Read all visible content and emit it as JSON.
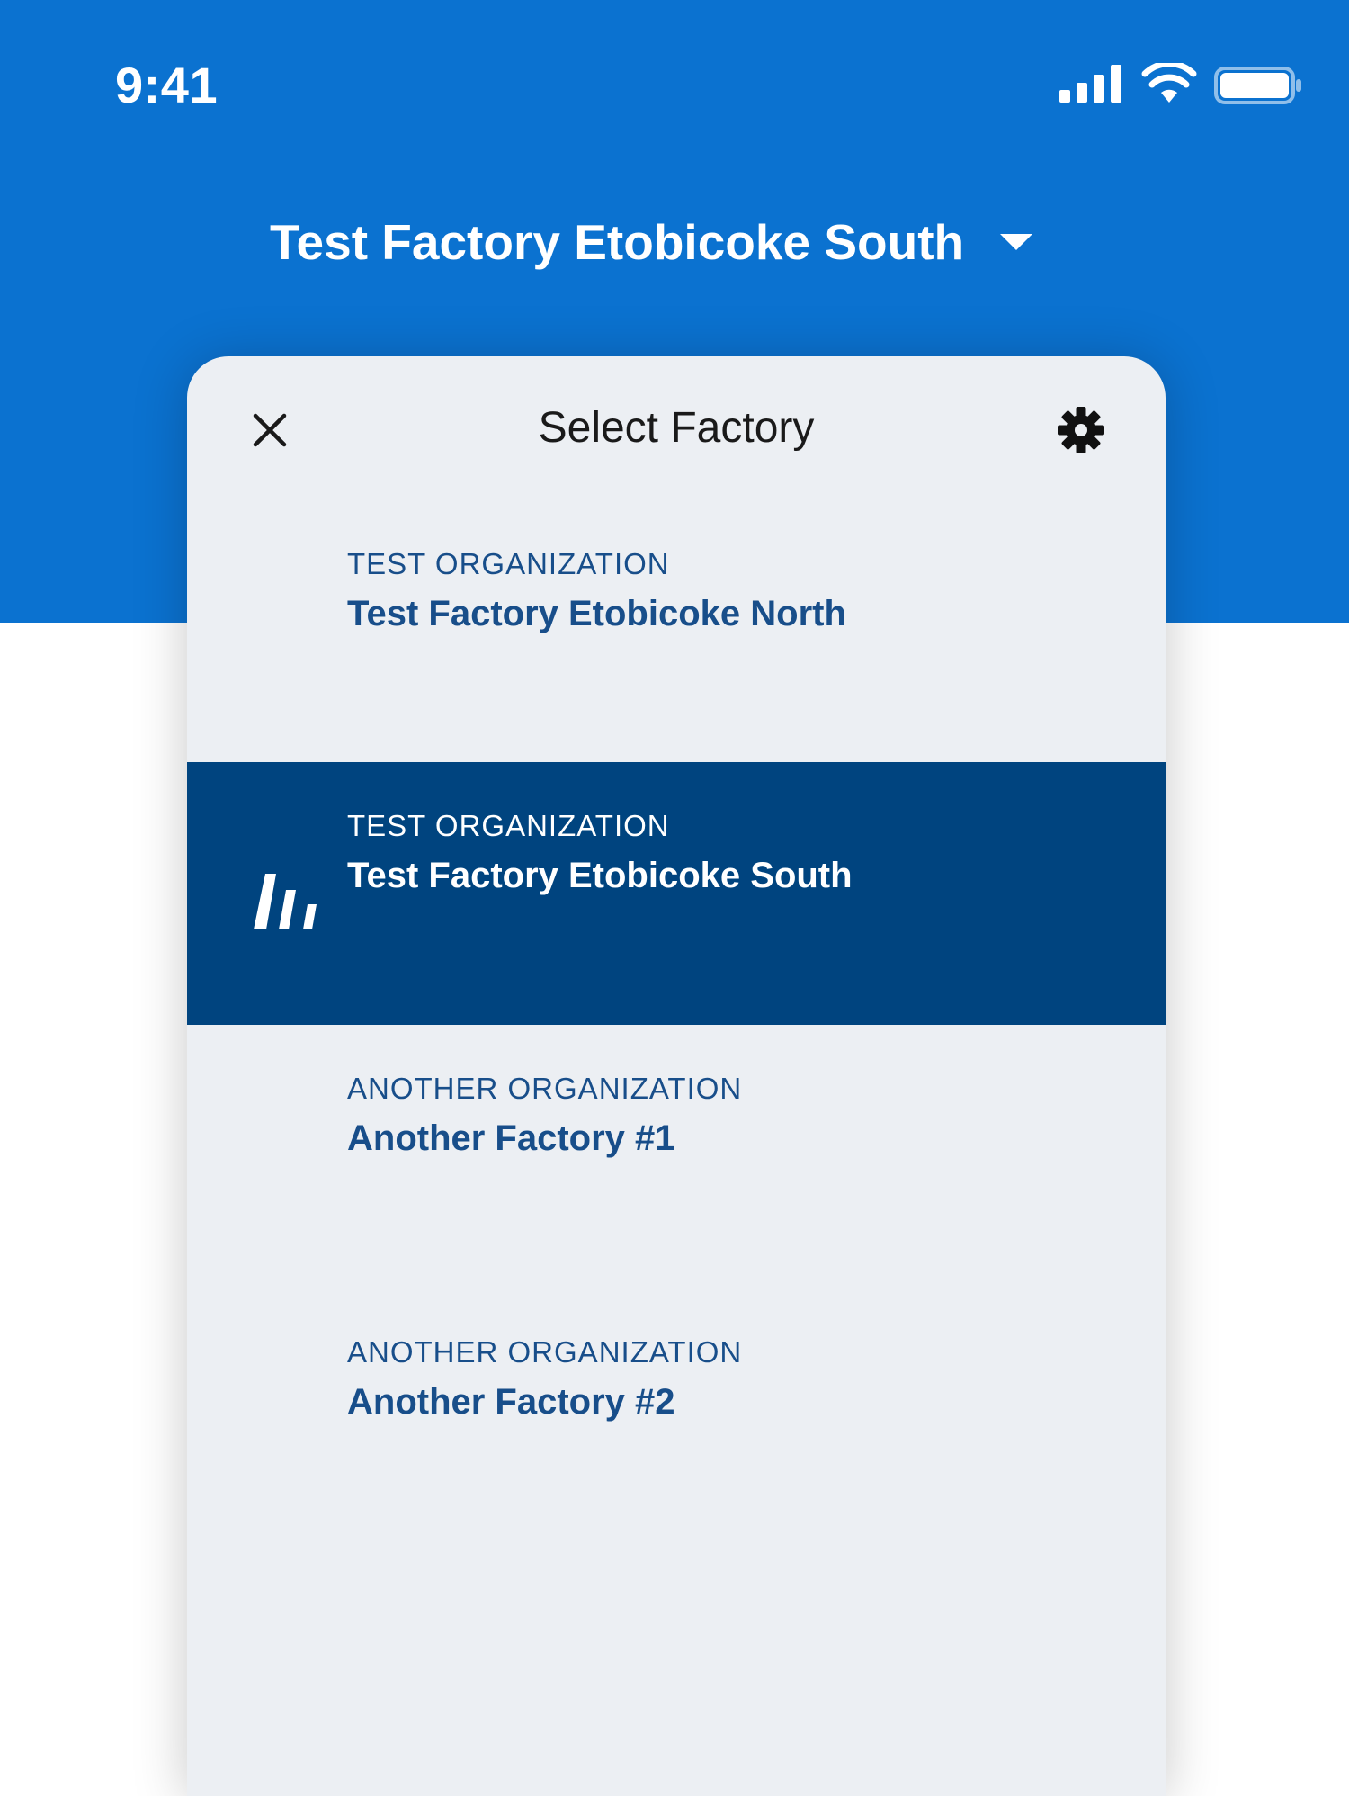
{
  "status_bar": {
    "time": "9:41",
    "icons": [
      "signal-icon",
      "wifi-icon",
      "battery-icon"
    ]
  },
  "header": {
    "current_factory": "Test Factory Etobicoke South",
    "dropdown_icon": "caret-down-icon"
  },
  "sheet": {
    "title": "Select Factory",
    "close_icon": "close-icon",
    "settings_icon": "gear-icon",
    "factories": [
      {
        "organization": "TEST ORGANIZATION",
        "name": "Test Factory Etobicoke North",
        "selected": false
      },
      {
        "organization": "TEST ORGANIZATION",
        "name": "Test Factory Etobicoke South",
        "selected": true
      },
      {
        "organization": "ANOTHER ORGANIZATION",
        "name": "Another Factory #1",
        "selected": false
      },
      {
        "organization": "ANOTHER ORGANIZATION",
        "name": "Another Factory #2",
        "selected": false
      }
    ]
  },
  "colors": {
    "header_blue": "#0b72d0",
    "selected_row": "#00447f",
    "sheet_background": "#eceff3",
    "item_text": "#184e8a"
  }
}
